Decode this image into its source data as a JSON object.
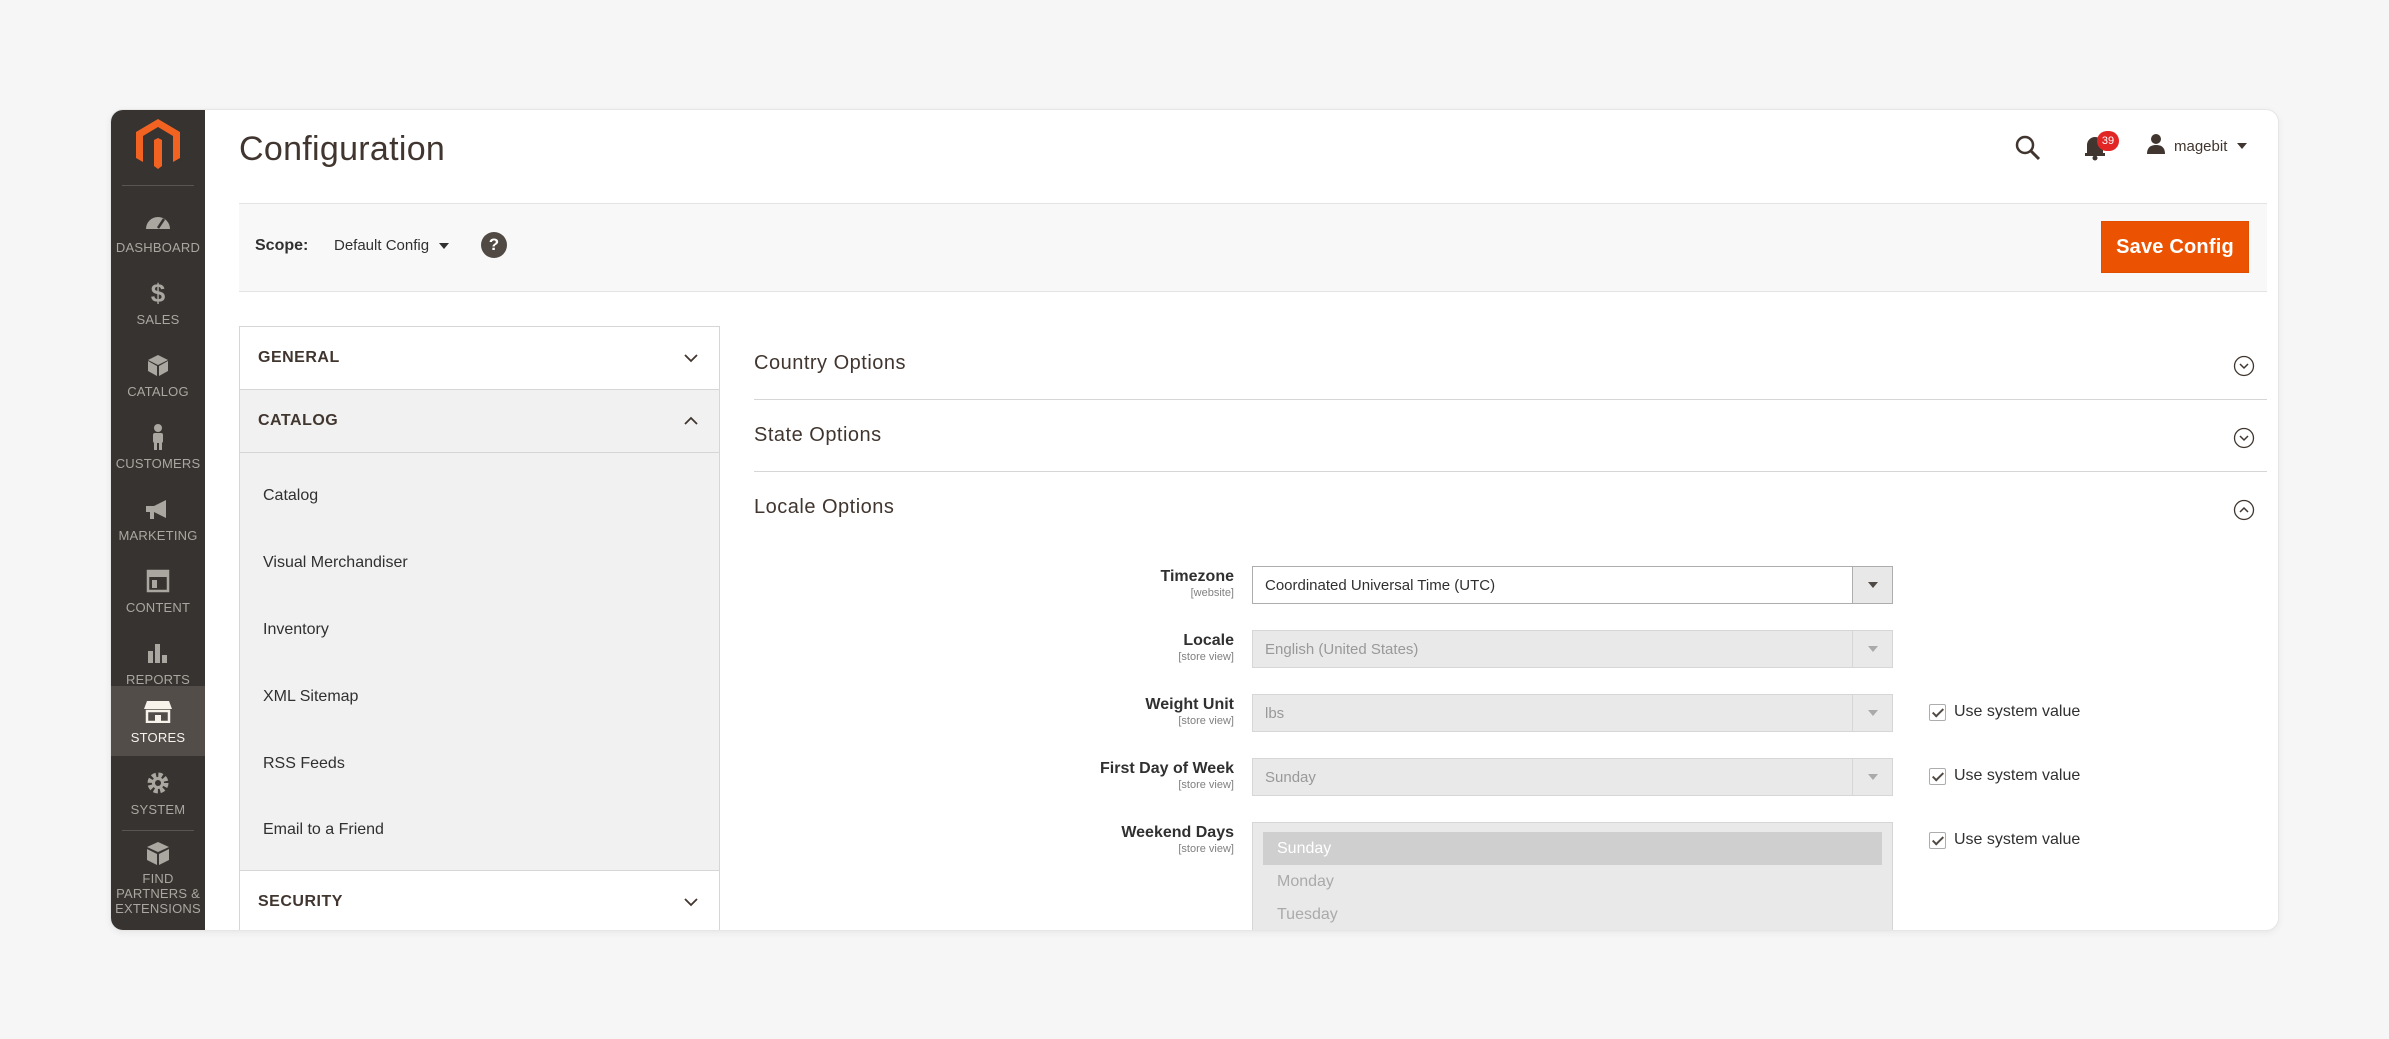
{
  "menu": {
    "items": [
      {
        "label": "DASHBOARD",
        "icon": "dashboard-icon"
      },
      {
        "label": "SALES",
        "icon": "dollar-icon"
      },
      {
        "label": "CATALOG",
        "icon": "box-icon"
      },
      {
        "label": "CUSTOMERS",
        "icon": "person-icon"
      },
      {
        "label": "MARKETING",
        "icon": "megaphone-icon"
      },
      {
        "label": "CONTENT",
        "icon": "layout-icon"
      },
      {
        "label": "REPORTS",
        "icon": "bar-chart-icon"
      },
      {
        "label": "STORES",
        "icon": "storefront-icon"
      },
      {
        "label": "SYSTEM",
        "icon": "gear-icon"
      },
      {
        "label": "FIND PARTNERS & EXTENSIONS",
        "icon": "extensions-box-icon"
      }
    ]
  },
  "header": {
    "title": "Configuration",
    "notifications_count": "39",
    "user_name": "magebit"
  },
  "scope": {
    "label": "Scope:",
    "value": "Default Config",
    "help": "?",
    "save_label": "Save Config"
  },
  "tabs": {
    "general": "GENERAL",
    "catalog": "CATALOG",
    "catalog_items": [
      "Catalog",
      "Visual Merchandiser",
      "Inventory",
      "XML Sitemap",
      "RSS Feeds",
      "Email to a Friend"
    ],
    "security": "SECURITY"
  },
  "sections": {
    "country": "Country Options",
    "state": "State Options",
    "locale": "Locale Options"
  },
  "fields": {
    "timezone": {
      "label": "Timezone",
      "scope": "[website]",
      "value": "Coordinated Universal Time (UTC)"
    },
    "locale": {
      "label": "Locale",
      "scope": "[store view]",
      "value": "English (United States)"
    },
    "weight_unit": {
      "label": "Weight Unit",
      "scope": "[store view]",
      "value": "lbs"
    },
    "first_day": {
      "label": "First Day of Week",
      "scope": "[store view]",
      "value": "Sunday"
    },
    "weekend_days": {
      "label": "Weekend Days",
      "scope": "[store view]",
      "options": [
        "Sunday",
        "Monday",
        "Tuesday"
      ],
      "selected": "Sunday"
    },
    "use_system_value": "Use system value"
  },
  "colors": {
    "accent": "#eb5202",
    "menu_bg": "#373330",
    "badge": "#e22626"
  }
}
